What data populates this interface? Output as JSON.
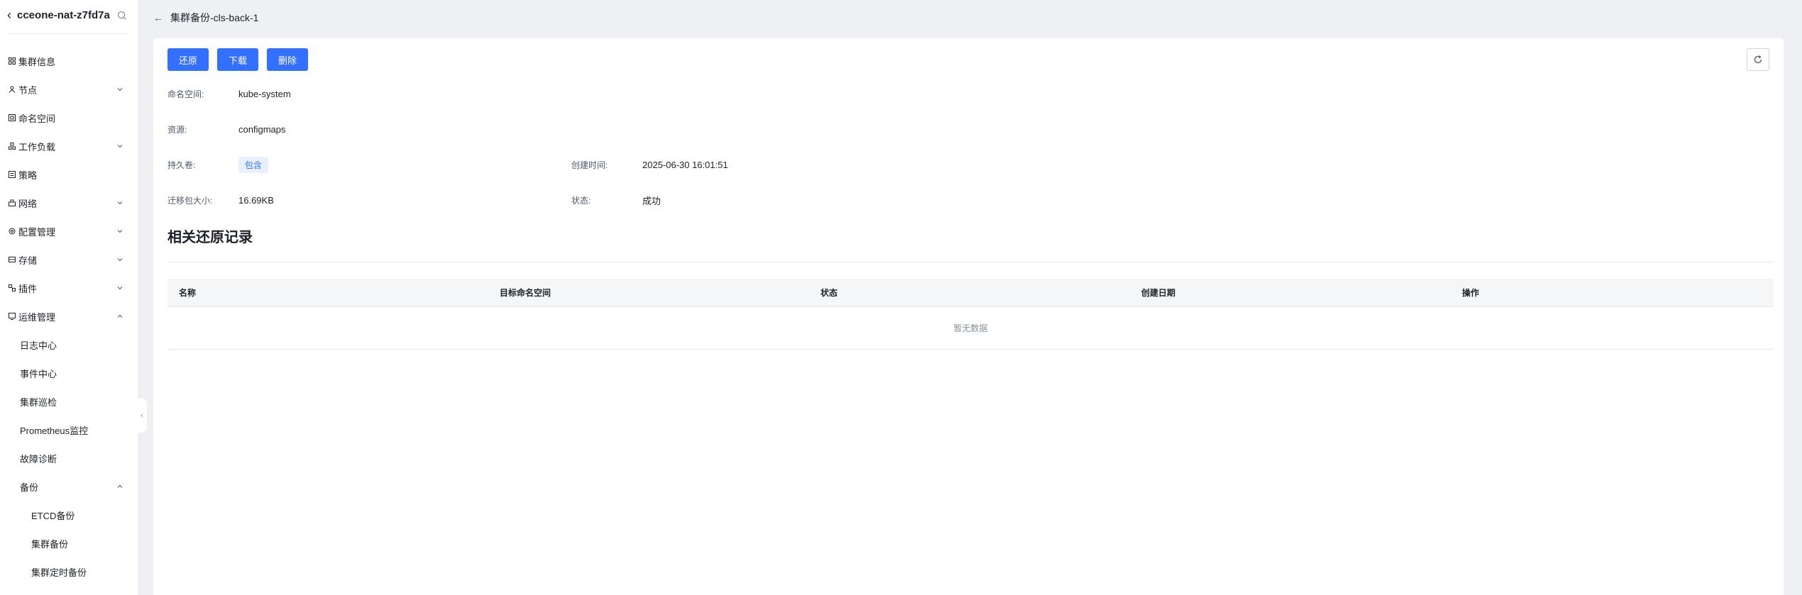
{
  "sidebar": {
    "cluster_name": "cceone-nat-z7fd7a",
    "items": [
      {
        "label": "集群信息",
        "icon": "grid-icon",
        "chevron": ""
      },
      {
        "label": "节点",
        "icon": "node-icon",
        "chevron": "down"
      },
      {
        "label": "命名空间",
        "icon": "namespace-icon",
        "chevron": ""
      },
      {
        "label": "工作负载",
        "icon": "workload-icon",
        "chevron": "down"
      },
      {
        "label": "策略",
        "icon": "policy-icon",
        "chevron": ""
      },
      {
        "label": "网络",
        "icon": "network-icon",
        "chevron": "down"
      },
      {
        "label": "配置管理",
        "icon": "config-icon",
        "chevron": "down"
      },
      {
        "label": "存储",
        "icon": "storage-icon",
        "chevron": "down"
      },
      {
        "label": "插件",
        "icon": "plugin-icon",
        "chevron": "down"
      },
      {
        "label": "运维管理",
        "icon": "ops-icon",
        "chevron": "up"
      }
    ],
    "ops_children": [
      "日志中心",
      "事件中心",
      "集群巡检",
      "Prometheus监控",
      "故障诊断"
    ],
    "backup_label": "备份",
    "backup_children": [
      "ETCD备份",
      "集群备份",
      "集群定时备份"
    ]
  },
  "header": {
    "title": "集群备份-cls-back-1"
  },
  "actions": {
    "restore": "还原",
    "download": "下载",
    "delete": "删除"
  },
  "details": {
    "namespace_label": "命名空间:",
    "namespace_value": "kube-system",
    "resource_label": "资源:",
    "resource_value": "configmaps",
    "pv_label": "持久卷:",
    "pv_value": "包含",
    "created_label": "创建时间:",
    "created_value": "2025-06-30 16:01:51",
    "size_label": "迁移包大小:",
    "size_value": "16.69KB",
    "status_label": "状态:",
    "status_value": "成功"
  },
  "restore_records": {
    "title": "相关还原记录",
    "columns": [
      "名称",
      "目标命名空间",
      "状态",
      "创建日期",
      "操作"
    ],
    "empty_text": "暂无数据"
  },
  "colors": {
    "primary": "#3370ff",
    "tag_bg": "#e8f0ff",
    "page_bg": "#eef0f3"
  }
}
